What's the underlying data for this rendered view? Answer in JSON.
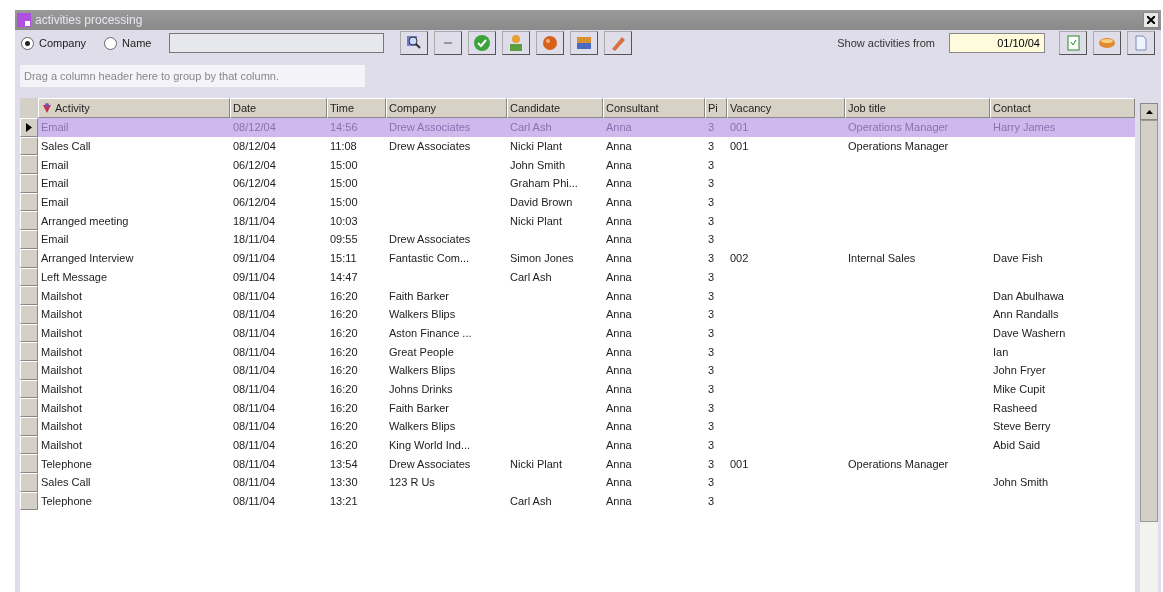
{
  "window": {
    "title": "activities processing"
  },
  "search_by": [
    {
      "label": "Company",
      "selected": true
    },
    {
      "label": "Name",
      "selected": false
    }
  ],
  "date_filter": {
    "label": "Show activities from",
    "value": "01/10/04"
  },
  "group_panel": {
    "hint": "Drag a column header here to group by that column."
  },
  "table": {
    "columns": [
      "Activity",
      "Date",
      "Time",
      "Company",
      "Candidate",
      "Consultant",
      "Pi",
      "Vacancy",
      "Job title",
      "Contact"
    ],
    "rows": [
      {
        "selected": true,
        "activity": "Email",
        "date": "08/12/04",
        "time": "14:56",
        "company": "Drew Associates",
        "candidate": "Carl Ash",
        "consultant": "Anna",
        "pi": "3",
        "vacancy": "001",
        "job_title": "Operations Manager",
        "contact": "Harry James"
      },
      {
        "selected": false,
        "activity": "Sales Call",
        "date": "08/12/04",
        "time": "11:08",
        "company": "Drew Associates",
        "candidate": "Nicki Plant",
        "consultant": "Anna",
        "pi": "3",
        "vacancy": "001",
        "job_title": "Operations Manager"
      },
      {
        "selected": false,
        "activity": "Email",
        "date": "06/12/04",
        "time": "15:00",
        "candidate": "John Smith",
        "consultant": "Anna",
        "pi": "3"
      },
      {
        "selected": false,
        "activity": "Email",
        "date": "06/12/04",
        "time": "15:00",
        "candidate": "Graham Phi...",
        "consultant": "Anna",
        "pi": "3"
      },
      {
        "selected": false,
        "activity": "Email",
        "date": "06/12/04",
        "time": "15:00",
        "candidate": "David Brown",
        "consultant": "Anna",
        "pi": "3"
      },
      {
        "selected": false,
        "activity": "Arranged meeting",
        "date": "18/11/04",
        "time": "10:03",
        "candidate": "Nicki Plant",
        "consultant": "Anna",
        "pi": "3"
      },
      {
        "selected": false,
        "activity": "Email",
        "date": "18/11/04",
        "time": "09:55",
        "company": "Drew Associates",
        "consultant": "Anna",
        "pi": "3"
      },
      {
        "selected": false,
        "activity": "Arranged Interview",
        "date": "09/11/04",
        "time": "15:11",
        "company": "Fantastic Com...",
        "candidate": "Simon Jones",
        "consultant": "Anna",
        "pi": "3",
        "vacancy": "002",
        "job_title": "Internal Sales",
        "contact": "Dave Fish"
      },
      {
        "selected": false,
        "activity": "Left Message",
        "date": "09/11/04",
        "time": "14:47",
        "candidate": "Carl Ash",
        "consultant": "Anna",
        "pi": "3"
      },
      {
        "selected": false,
        "activity": "Mailshot",
        "date": "08/11/04",
        "time": "16:20",
        "company": "Faith Barker",
        "consultant": "Anna",
        "pi": "3",
        "contact": "Dan Abulhawa"
      },
      {
        "selected": false,
        "activity": "Mailshot",
        "date": "08/11/04",
        "time": "16:20",
        "company": "Walkers Blips",
        "consultant": "Anna",
        "pi": "3",
        "contact": "Ann Randalls"
      },
      {
        "selected": false,
        "activity": "Mailshot",
        "date": "08/11/04",
        "time": "16:20",
        "company": "Aston Finance ...",
        "consultant": "Anna",
        "pi": "3",
        "contact": "Dave Washern"
      },
      {
        "selected": false,
        "activity": "Mailshot",
        "date": "08/11/04",
        "time": "16:20",
        "company": "Great People",
        "consultant": "Anna",
        "pi": "3",
        "contact": "Ian"
      },
      {
        "selected": false,
        "activity": "Mailshot",
        "date": "08/11/04",
        "time": "16:20",
        "company": "Walkers Blips",
        "consultant": "Anna",
        "pi": "3",
        "contact": "John Fryer"
      },
      {
        "selected": false,
        "activity": "Mailshot",
        "date": "08/11/04",
        "time": "16:20",
        "company": "Johns Drinks",
        "consultant": "Anna",
        "pi": "3",
        "contact": "Mike Cupit"
      },
      {
        "selected": false,
        "activity": "Mailshot",
        "date": "08/11/04",
        "time": "16:20",
        "company": "Faith Barker",
        "consultant": "Anna",
        "pi": "3",
        "contact": "Rasheed"
      },
      {
        "selected": false,
        "activity": "Mailshot",
        "date": "08/11/04",
        "time": "16:20",
        "company": "Walkers Blips",
        "consultant": "Anna",
        "pi": "3",
        "contact": "Steve Berry"
      },
      {
        "selected": false,
        "activity": "Mailshot",
        "date": "08/11/04",
        "time": "16:20",
        "company": "King World Ind...",
        "consultant": "Anna",
        "pi": "3",
        "contact": "Abid Said"
      },
      {
        "selected": false,
        "activity": "Telephone",
        "date": "08/11/04",
        "time": "13:54",
        "company": "Drew Associates",
        "candidate": "Nicki Plant",
        "consultant": "Anna",
        "pi": "3",
        "vacancy": "001",
        "job_title": "Operations Manager"
      },
      {
        "selected": false,
        "activity": "Sales Call",
        "date": "08/11/04",
        "time": "13:30",
        "company": "123 R Us",
        "consultant": "Anna",
        "pi": "3",
        "contact": "John Smith"
      },
      {
        "selected": false,
        "activity": "Telephone",
        "date": "08/11/04",
        "time": "13:21",
        "candidate": "Carl Ash",
        "consultant": "Anna",
        "pi": "3"
      }
    ]
  }
}
